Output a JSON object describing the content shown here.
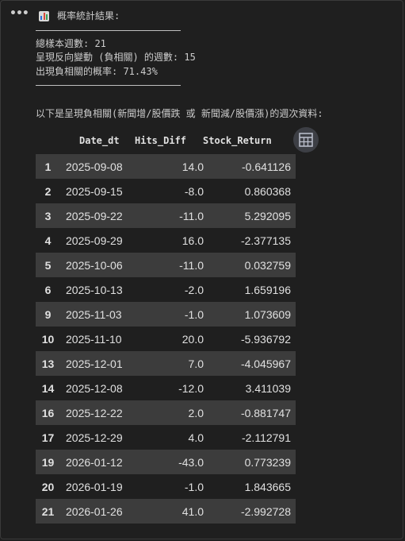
{
  "cell": {
    "menu_glyph": "•••"
  },
  "output": {
    "title": "概率統計結果:",
    "lines": [
      "總樣本週數: 21",
      "呈現反向變動 (負相關) 的週數: 15",
      "出現負相關的概率: 71.43%"
    ],
    "table_caption": "以下是呈現負相關(新聞增/股價跌 或 新聞減/股價漲)的週次資料:"
  },
  "table": {
    "columns": [
      "Date_dt",
      "Hits_Diff",
      "Stock_Return"
    ],
    "rows": [
      {
        "idx": "1",
        "date": "2025-09-08",
        "hits": "14.0",
        "ret": "-0.641126"
      },
      {
        "idx": "2",
        "date": "2025-09-15",
        "hits": "-8.0",
        "ret": "0.860368"
      },
      {
        "idx": "3",
        "date": "2025-09-22",
        "hits": "-11.0",
        "ret": "5.292095"
      },
      {
        "idx": "4",
        "date": "2025-09-29",
        "hits": "16.0",
        "ret": "-2.377135"
      },
      {
        "idx": "5",
        "date": "2025-10-06",
        "hits": "-11.0",
        "ret": "0.032759"
      },
      {
        "idx": "6",
        "date": "2025-10-13",
        "hits": "-2.0",
        "ret": "1.659196"
      },
      {
        "idx": "9",
        "date": "2025-11-03",
        "hits": "-1.0",
        "ret": "1.073609"
      },
      {
        "idx": "10",
        "date": "2025-11-10",
        "hits": "20.0",
        "ret": "-5.936792"
      },
      {
        "idx": "13",
        "date": "2025-12-01",
        "hits": "7.0",
        "ret": "-4.045967"
      },
      {
        "idx": "14",
        "date": "2025-12-08",
        "hits": "-12.0",
        "ret": "3.411039"
      },
      {
        "idx": "16",
        "date": "2025-12-22",
        "hits": "2.0",
        "ret": "-0.881747"
      },
      {
        "idx": "17",
        "date": "2025-12-29",
        "hits": "4.0",
        "ret": "-2.112791"
      },
      {
        "idx": "19",
        "date": "2026-01-12",
        "hits": "-43.0",
        "ret": "0.773239"
      },
      {
        "idx": "20",
        "date": "2026-01-19",
        "hits": "-1.0",
        "ret": "1.843665"
      },
      {
        "idx": "21",
        "date": "2026-01-26",
        "hits": "41.0",
        "ret": "-2.992728"
      }
    ]
  },
  "colors": {
    "background": "#1f1f1f",
    "row_stripe": "#3c3c3c",
    "text": "#cccccc"
  }
}
